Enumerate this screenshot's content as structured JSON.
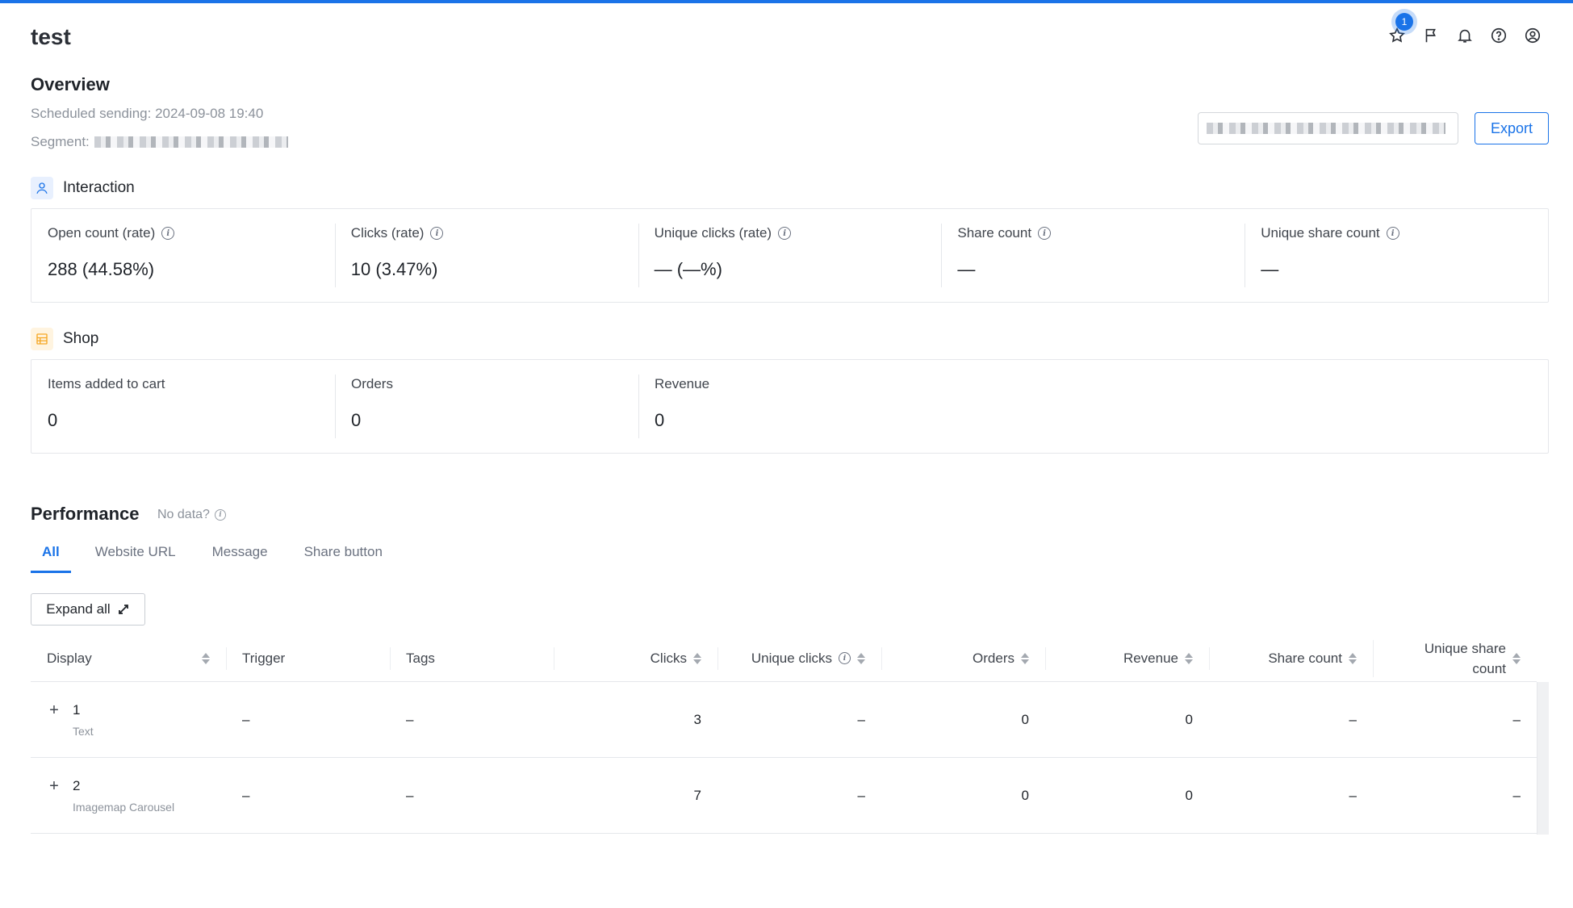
{
  "page": {
    "title": "test",
    "notification_badge": "1"
  },
  "overview": {
    "title": "Overview",
    "scheduled": "Scheduled sending: 2024-09-08 19:40",
    "segment_label": "Segment:"
  },
  "actions": {
    "export_label": "Export"
  },
  "interaction": {
    "title": "Interaction",
    "stats": [
      {
        "label": "Open count (rate)",
        "value": "288 (44.58%)"
      },
      {
        "label": "Clicks (rate)",
        "value": "10 (3.47%)"
      },
      {
        "label": "Unique clicks (rate)",
        "value": "— (—%)"
      },
      {
        "label": "Share count",
        "value": "—"
      },
      {
        "label": "Unique share count",
        "value": "—"
      }
    ]
  },
  "shop": {
    "title": "Shop",
    "stats": [
      {
        "label": "Items added to cart",
        "value": "0"
      },
      {
        "label": "Orders",
        "value": "0"
      },
      {
        "label": "Revenue",
        "value": "0"
      }
    ]
  },
  "performance": {
    "title": "Performance",
    "no_data": "No data?",
    "tabs": [
      "All",
      "Website URL",
      "Message",
      "Share button"
    ],
    "expand_label": "Expand all",
    "columns": [
      "Display",
      "Trigger",
      "Tags",
      "Clicks",
      "Unique clicks",
      "Orders",
      "Revenue",
      "Share count",
      "Unique share count"
    ],
    "rows": [
      {
        "num": "1",
        "type": "Text",
        "trigger": "–",
        "tags": "–",
        "clicks": "3",
        "unique_clicks": "–",
        "orders": "0",
        "revenue": "0",
        "share_count": "–",
        "unique_share_count": "–"
      },
      {
        "num": "2",
        "type": "Imagemap Carousel",
        "trigger": "–",
        "tags": "–",
        "clicks": "7",
        "unique_clicks": "–",
        "orders": "0",
        "revenue": "0",
        "share_count": "–",
        "unique_share_count": "–"
      }
    ]
  },
  "colors": {
    "accent": "#1a73e8",
    "shop_icon": "#f5a623"
  },
  "icons": [
    "star-icon",
    "flag-icon",
    "bell-icon",
    "help-icon",
    "account-icon",
    "user-icon",
    "store-icon",
    "info-icon",
    "expand-icon",
    "plus-icon",
    "sort-icon"
  ]
}
